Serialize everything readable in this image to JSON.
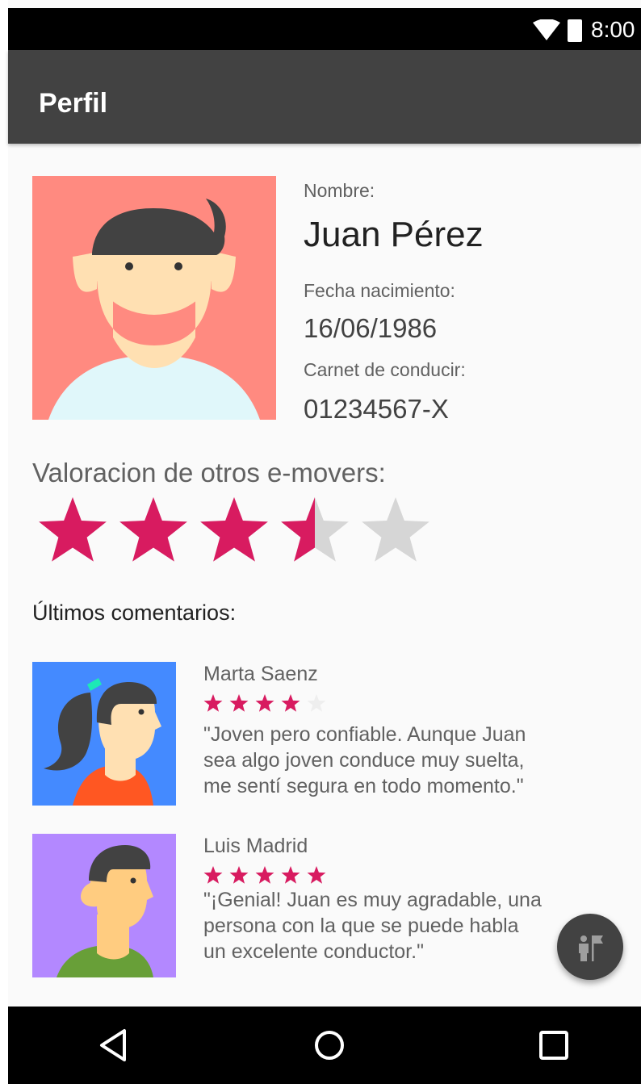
{
  "status_bar": {
    "time": "8:00",
    "icons": [
      "wifi-icon",
      "battery-icon"
    ]
  },
  "app_bar": {
    "title": "Perfil"
  },
  "profile": {
    "name_label": "Nombre:",
    "name": "Juan Pérez",
    "birth_label": "Fecha nacimiento:",
    "birth_date": "16/06/1986",
    "license_label": "Carnet de conducir:",
    "license": "01234567-X",
    "rating_label": "Valoracion de otros e-movers:",
    "rating": 3.5,
    "rating_max": 5
  },
  "comments": {
    "heading": "Últimos comentarios:",
    "items": [
      {
        "author": "Marta Saenz",
        "rating": 4,
        "text_lines": [
          "\"Joven pero confiable. Aunque Juan",
          "sea algo joven conduce muy suelta,",
          "me sentí segura en todo momento.\""
        ]
      },
      {
        "author": "Luis Madrid",
        "rating": 5,
        "text_lines": [
          "\"¡Genial! Juan es muy agradable, una",
          "persona con la que se puede habla",
          "un excelente conductor.\""
        ]
      }
    ]
  },
  "colors": {
    "accent": "#d81b60",
    "star_empty": "#d6d6d6",
    "app_bar": "#424242",
    "avatar_main_bg": "#ff8a80",
    "avatar_1_bg": "#448aff",
    "avatar_2_bg": "#b388ff"
  },
  "fab": {
    "icon": "guide-flag-icon"
  },
  "nav_bar": {
    "buttons": [
      "back-icon",
      "home-icon",
      "recents-icon"
    ]
  }
}
